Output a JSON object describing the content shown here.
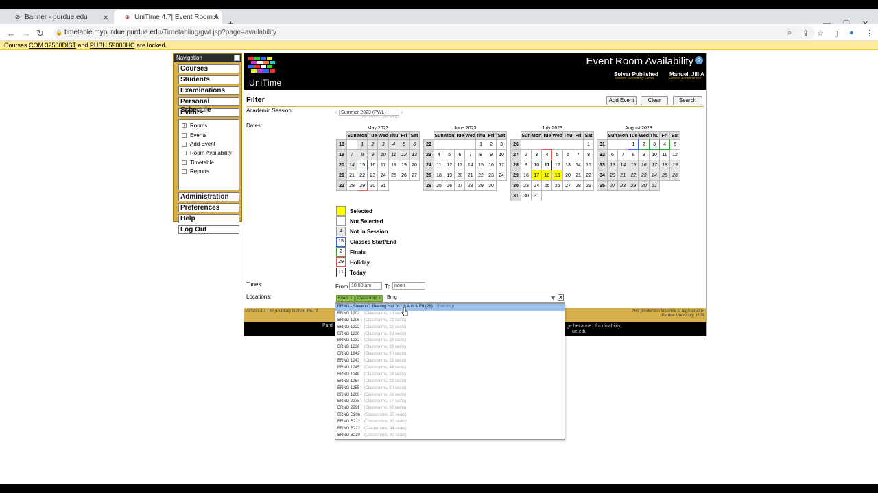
{
  "browser": {
    "tabs": [
      {
        "title": "Banner - purdue.edu",
        "icon": "banner-icon"
      },
      {
        "title": "UniTime 4.7| Event Room Availab",
        "icon": "unitime-icon"
      }
    ],
    "url_host": "timetable.mypurdue.purdue.edu",
    "url_path": "/Timetabling/gwt.jsp?page=availability"
  },
  "lockbar": {
    "prefix": "Courses ",
    "course1": "COM 32500DIST",
    "mid": " and ",
    "course2": "PUBH 59000HC",
    "suffix": " are locked."
  },
  "nav": {
    "title": "Navigation",
    "top_items": [
      "Courses",
      "Students",
      "Examinations",
      "Personal Schedule",
      "Events"
    ],
    "sub_items": [
      {
        "label": "Rooms",
        "icon": "+"
      },
      {
        "label": "Events",
        "icon": ""
      },
      {
        "label": "Add Event",
        "icon": ""
      },
      {
        "label": "Room Availability",
        "icon": ""
      },
      {
        "label": "Timetable",
        "icon": ""
      },
      {
        "label": "Reports",
        "icon": ""
      }
    ],
    "bottom_items": [
      "Administration",
      "Preferences",
      "Help",
      "Log Out"
    ]
  },
  "header": {
    "logo_text": "UniTime",
    "title": "Event Room Availability",
    "help": "?",
    "solver": "Solver Published",
    "solver_sub": "Student Sectioning Solver",
    "user": "Manuel, Jill A",
    "user_sub": "Session Administrator"
  },
  "filter": {
    "heading": "Filter",
    "buttons": {
      "add": "Add Event",
      "clear": "Clear",
      "search": "Search"
    },
    "session_label": "Academic Session:",
    "session_prev": "«",
    "session_value": "Summer 2023 (PWL)",
    "session_next": "»",
    "session_dates": "05/15/2023 - 08/13/2023",
    "dates_label": "Dates:",
    "times_label": "Times:",
    "from_label": "From",
    "from_value": "10:00 am",
    "to_label": "To",
    "to_value": "noon",
    "locations_label": "Locations:",
    "chips": [
      "Event ×",
      "Classroom ×"
    ],
    "location_text": "Brng"
  },
  "calendar": {
    "day_headers": [
      "Sun",
      "Mon",
      "Tue",
      "Wed",
      "Thu",
      "Fri",
      "Sat"
    ],
    "months": [
      {
        "name": "May 2023",
        "weeks": [
          {
            "wk": "18",
            "days": [
              [
                "",
                ""
              ],
              [
                "1",
                "ni"
              ],
              [
                "2",
                "ni"
              ],
              [
                "3",
                "ni"
              ],
              [
                "4",
                "ni"
              ],
              [
                "5",
                "ni"
              ],
              [
                "6",
                "ni"
              ]
            ]
          },
          {
            "wk": "19",
            "days": [
              [
                "7",
                "ni"
              ],
              [
                "8",
                "ni"
              ],
              [
                "9",
                "ni"
              ],
              [
                "10",
                "ni"
              ],
              [
                "11",
                "ni"
              ],
              [
                "12",
                "ni"
              ],
              [
                "13",
                "ni"
              ]
            ]
          },
          {
            "wk": "20",
            "days": [
              [
                "14",
                "ni"
              ],
              [
                "15",
                "cls"
              ],
              [
                "16",
                ""
              ],
              [
                "17",
                ""
              ],
              [
                "18",
                ""
              ],
              [
                "19",
                ""
              ],
              [
                "20",
                ""
              ]
            ]
          },
          {
            "wk": "21",
            "days": [
              [
                "21",
                ""
              ],
              [
                "22",
                ""
              ],
              [
                "23",
                ""
              ],
              [
                "24",
                ""
              ],
              [
                "25",
                ""
              ],
              [
                "26",
                ""
              ],
              [
                "27",
                ""
              ]
            ]
          },
          {
            "wk": "22",
            "days": [
              [
                "28",
                ""
              ],
              [
                "29",
                "hol"
              ],
              [
                "30",
                ""
              ],
              [
                "31",
                ""
              ],
              [
                "",
                ""
              ],
              [
                "",
                ""
              ],
              [
                "",
                ""
              ]
            ]
          }
        ]
      },
      {
        "name": "June 2023",
        "weeks": [
          {
            "wk": "22",
            "days": [
              [
                "",
                ""
              ],
              [
                "",
                ""
              ],
              [
                "",
                ""
              ],
              [
                "",
                ""
              ],
              [
                "1",
                ""
              ],
              [
                "2",
                ""
              ],
              [
                "3",
                ""
              ]
            ]
          },
          {
            "wk": "23",
            "days": [
              [
                "4",
                ""
              ],
              [
                "5",
                ""
              ],
              [
                "6",
                ""
              ],
              [
                "7",
                ""
              ],
              [
                "8",
                ""
              ],
              [
                "9",
                ""
              ],
              [
                "10",
                ""
              ]
            ]
          },
          {
            "wk": "24",
            "days": [
              [
                "11",
                ""
              ],
              [
                "12",
                ""
              ],
              [
                "13",
                ""
              ],
              [
                "14",
                ""
              ],
              [
                "15",
                ""
              ],
              [
                "16",
                ""
              ],
              [
                "17",
                ""
              ]
            ]
          },
          {
            "wk": "25",
            "days": [
              [
                "18",
                ""
              ],
              [
                "19",
                ""
              ],
              [
                "20",
                ""
              ],
              [
                "21",
                ""
              ],
              [
                "22",
                ""
              ],
              [
                "23",
                ""
              ],
              [
                "24",
                ""
              ]
            ]
          },
          {
            "wk": "26",
            "days": [
              [
                "25",
                ""
              ],
              [
                "26",
                ""
              ],
              [
                "27",
                ""
              ],
              [
                "28",
                ""
              ],
              [
                "29",
                ""
              ],
              [
                "30",
                ""
              ],
              [
                "",
                ""
              ]
            ]
          }
        ]
      },
      {
        "name": "July 2023",
        "weeks": [
          {
            "wk": "26",
            "days": [
              [
                "",
                ""
              ],
              [
                "",
                ""
              ],
              [
                "",
                ""
              ],
              [
                "",
                ""
              ],
              [
                "",
                ""
              ],
              [
                "",
                ""
              ],
              [
                "1",
                ""
              ]
            ]
          },
          {
            "wk": "27",
            "days": [
              [
                "2",
                ""
              ],
              [
                "3",
                ""
              ],
              [
                "4",
                "hol"
              ],
              [
                "5",
                ""
              ],
              [
                "6",
                ""
              ],
              [
                "7",
                ""
              ],
              [
                "8",
                ""
              ]
            ]
          },
          {
            "wk": "28",
            "days": [
              [
                "9",
                ""
              ],
              [
                "10",
                ""
              ],
              [
                "11",
                "tod"
              ],
              [
                "12",
                ""
              ],
              [
                "13",
                ""
              ],
              [
                "14",
                ""
              ],
              [
                "15",
                ""
              ]
            ]
          },
          {
            "wk": "29",
            "days": [
              [
                "16",
                ""
              ],
              [
                "17",
                "sel"
              ],
              [
                "18",
                "sel"
              ],
              [
                "19",
                "sel"
              ],
              [
                "20",
                ""
              ],
              [
                "21",
                ""
              ],
              [
                "22",
                ""
              ]
            ]
          },
          {
            "wk": "30",
            "days": [
              [
                "23",
                ""
              ],
              [
                "24",
                ""
              ],
              [
                "25",
                ""
              ],
              [
                "26",
                ""
              ],
              [
                "27",
                ""
              ],
              [
                "28",
                ""
              ],
              [
                "29",
                ""
              ]
            ]
          },
          {
            "wk": "31",
            "days": [
              [
                "30",
                ""
              ],
              [
                "31",
                ""
              ],
              [
                "",
                ""
              ],
              [
                "",
                ""
              ],
              [
                "",
                ""
              ],
              [
                "",
                ""
              ],
              [
                "",
                ""
              ]
            ]
          }
        ]
      },
      {
        "name": "August 2023",
        "weeks": [
          {
            "wk": "31",
            "days": [
              [
                "",
                ""
              ],
              [
                "",
                ""
              ],
              [
                "1",
                "cls"
              ],
              [
                "2",
                "fin"
              ],
              [
                "3",
                "fin"
              ],
              [
                "4",
                "fin"
              ],
              [
                "5",
                ""
              ]
            ]
          },
          {
            "wk": "32",
            "days": [
              [
                "6",
                ""
              ],
              [
                "7",
                ""
              ],
              [
                "8",
                ""
              ],
              [
                "9",
                ""
              ],
              [
                "10",
                ""
              ],
              [
                "11",
                ""
              ],
              [
                "12",
                ""
              ]
            ]
          },
          {
            "wk": "33",
            "days": [
              [
                "13",
                "ni"
              ],
              [
                "14",
                "ni"
              ],
              [
                "15",
                "ni"
              ],
              [
                "16",
                "ni"
              ],
              [
                "17",
                "ni"
              ],
              [
                "18",
                "ni"
              ],
              [
                "19",
                "ni"
              ]
            ]
          },
          {
            "wk": "34",
            "days": [
              [
                "20",
                "ni"
              ],
              [
                "21",
                "ni"
              ],
              [
                "22",
                "ni"
              ],
              [
                "23",
                "ni"
              ],
              [
                "24",
                "ni"
              ],
              [
                "25",
                "ni"
              ],
              [
                "26",
                "ni"
              ]
            ]
          },
          {
            "wk": "35",
            "days": [
              [
                "27",
                "ni"
              ],
              [
                "28",
                "ni"
              ],
              [
                "29",
                "ni"
              ],
              [
                "30",
                "ni"
              ],
              [
                "31",
                "ni"
              ],
              [
                "",
                ""
              ],
              [
                "",
                ""
              ]
            ]
          }
        ]
      }
    ]
  },
  "legend": [
    {
      "label": "Selected",
      "swatch": "",
      "cls": "sel"
    },
    {
      "label": "Not Selected",
      "swatch": "",
      "cls": ""
    },
    {
      "label": "Not in Session",
      "swatch": "1",
      "cls": "ni"
    },
    {
      "label": "Classes Start/End",
      "swatch": "15",
      "cls": "cls"
    },
    {
      "label": "Finals",
      "swatch": "2",
      "cls": "fin"
    },
    {
      "label": "Holiday",
      "swatch": "29",
      "cls": "hol"
    },
    {
      "label": "Today",
      "swatch": "11",
      "cls": "tod"
    }
  ],
  "footer": {
    "left": "Version 4.7.132 (Purdue) built on Thu, 1",
    "right1": "This production instance is registered to",
    "right2": "Purdue University, USA",
    "black_left": "Purd",
    "black_right": "ge because of a disability,",
    "black_right2": "ue.edu"
  },
  "dropdown": [
    {
      "name": "BRNG - Steven C. Beering Hall of Lib Arts & Ed (26)",
      "desc": "(Building)"
    },
    {
      "name": "BRNG 1202",
      "desc": "(Classrooms, 18 seats)"
    },
    {
      "name": "BRNG 1206",
      "desc": "(Classrooms, 21 seats)"
    },
    {
      "name": "BRNG 1222",
      "desc": "(Classrooms, 32 seats)"
    },
    {
      "name": "BRNG 1230",
      "desc": "(Classrooms, 36 seats)"
    },
    {
      "name": "BRNG 1232",
      "desc": "(Classrooms, 33 seats)"
    },
    {
      "name": "BRNG 1238",
      "desc": "(Classrooms, 33 seats)"
    },
    {
      "name": "BRNG 1242",
      "desc": "(Classrooms, 30 seats)"
    },
    {
      "name": "BRNG 1243",
      "desc": "(Classrooms, 33 seats)"
    },
    {
      "name": "BRNG 1245",
      "desc": "(Classrooms, 44 seats)"
    },
    {
      "name": "BRNG 1248",
      "desc": "(Classrooms, 24 seats)"
    },
    {
      "name": "BRNG 1254",
      "desc": "(Classrooms, 33 seats)"
    },
    {
      "name": "BRNG 1255",
      "desc": "(Classrooms, 30 seats)"
    },
    {
      "name": "BRNG 1260",
      "desc": "(Classrooms, 36 seats)"
    },
    {
      "name": "BRNG 2275",
      "desc": "(Classrooms, 27 seats)"
    },
    {
      "name": "BRNG 2291",
      "desc": "(Classrooms, 32 seats)"
    },
    {
      "name": "BRNG B206",
      "desc": "(Classrooms, 35 seats)"
    },
    {
      "name": "BRNG B212",
      "desc": "(Classrooms, 30 seats)"
    },
    {
      "name": "BRNG B222",
      "desc": "(Classrooms, 44 seats)"
    },
    {
      "name": "BRNG B230",
      "desc": "(Classrooms, 30 seats)"
    }
  ],
  "colors": {
    "accent_gold": "#d8b04a",
    "selected": "#ffff00",
    "dropdown_highlight": "#9fc3ef"
  }
}
